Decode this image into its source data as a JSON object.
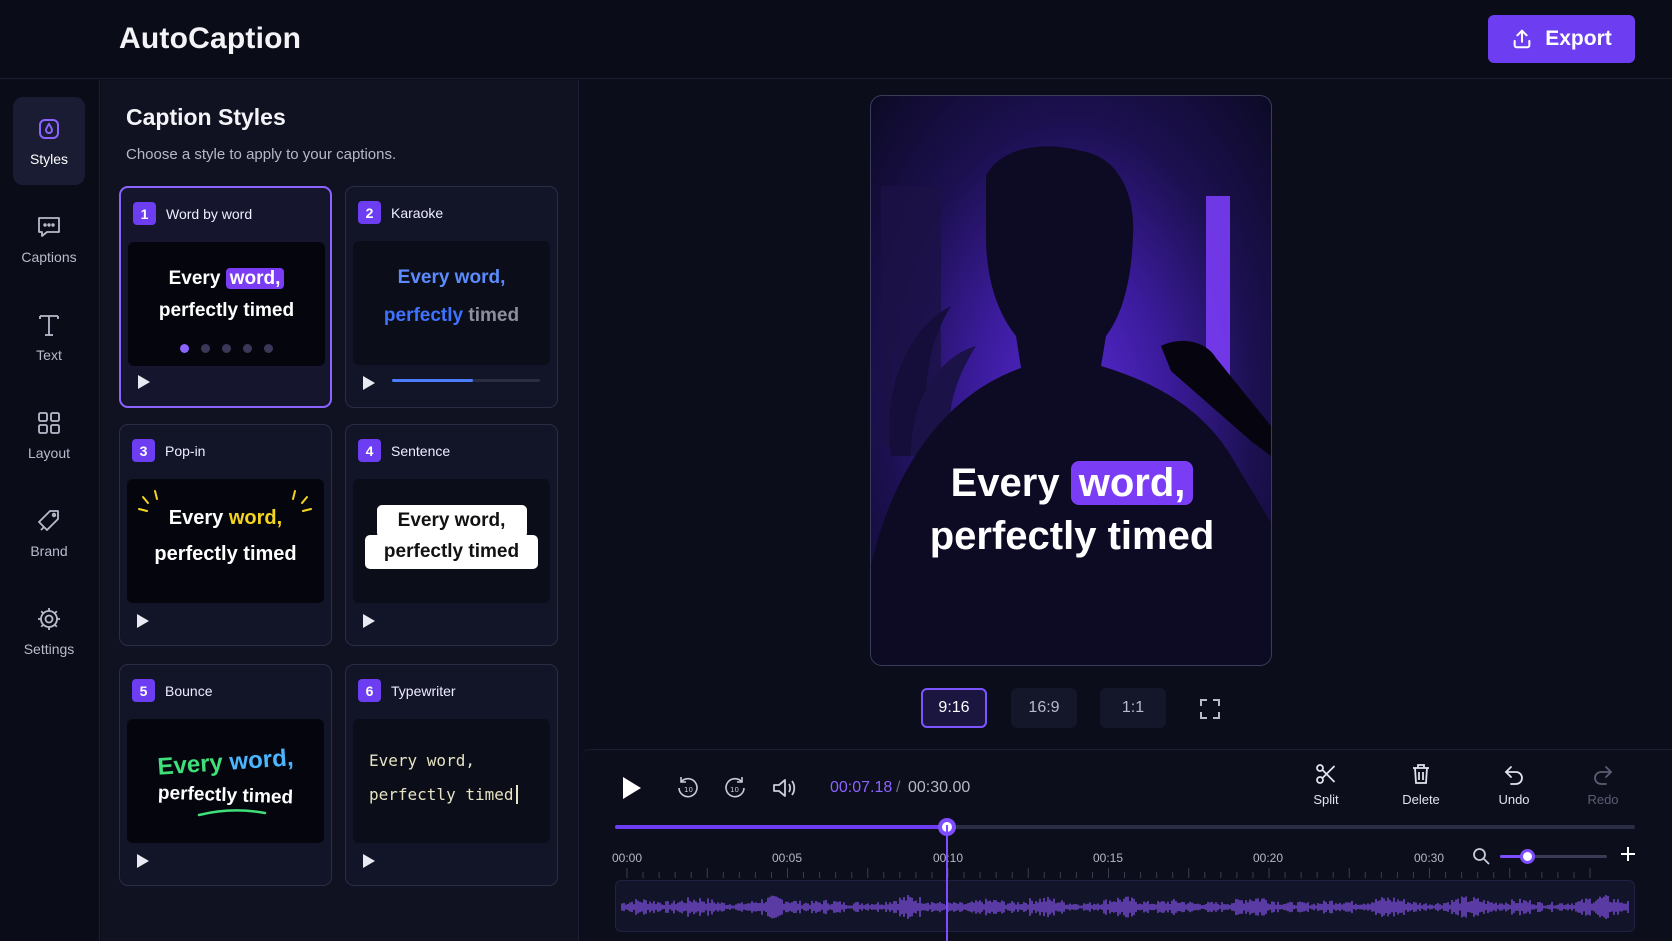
{
  "app": {
    "title": "AutoCaption",
    "export_label": "Export"
  },
  "colors": {
    "accent": "#6d3df2",
    "accent_light": "#8b63ff",
    "background": "#0b0d1a"
  },
  "sidebar": {
    "items": [
      {
        "label": "Styles",
        "icon": "styles-icon",
        "active": true
      },
      {
        "label": "Captions",
        "icon": "captions-icon"
      },
      {
        "label": "Text",
        "icon": "text-icon"
      },
      {
        "label": "Layout",
        "icon": "layout-icon"
      },
      {
        "label": "Brand",
        "icon": "brand-icon"
      },
      {
        "label": "Settings",
        "icon": "gear-icon"
      }
    ]
  },
  "panel": {
    "title": "Caption Styles",
    "subtitle": "Choose a style to apply to your captions.",
    "cards": [
      {
        "num": "1",
        "name": "Word by word",
        "selected": true
      },
      {
        "num": "2",
        "name": "Karaoke",
        "progress": 0.55
      },
      {
        "num": "3",
        "name": "Pop-in"
      },
      {
        "num": "4",
        "name": "Sentence"
      },
      {
        "num": "5",
        "name": "Bounce"
      },
      {
        "num": "6",
        "name": "Typewriter"
      }
    ],
    "preview_text": {
      "every": "Every",
      "word": "word,",
      "line2": "perfectly timed",
      "perfectly": "perfectly",
      "timed": "timed",
      "every_word": "Every word,"
    }
  },
  "preview": {
    "caption_every": "Every",
    "caption_word": "word,",
    "caption_line2": "perfectly timed",
    "ratios": [
      {
        "label": "9:16",
        "active": true
      },
      {
        "label": "16:9"
      },
      {
        "label": "1:1"
      }
    ]
  },
  "timeline": {
    "current_time": "00:07.18",
    "separator": "/",
    "total_time": "00:30.00",
    "progress": 0.325,
    "zoom_level": 0.25,
    "tools": [
      {
        "label": "Split",
        "icon": "scissors-icon"
      },
      {
        "label": "Delete",
        "icon": "trash-icon"
      },
      {
        "label": "Undo",
        "icon": "undo-icon"
      },
      {
        "label": "Redo",
        "icon": "redo-icon",
        "disabled": true
      }
    ],
    "ticks": [
      "00:00",
      "00:05",
      "00:10",
      "00:15",
      "00:20",
      "00:30"
    ]
  }
}
